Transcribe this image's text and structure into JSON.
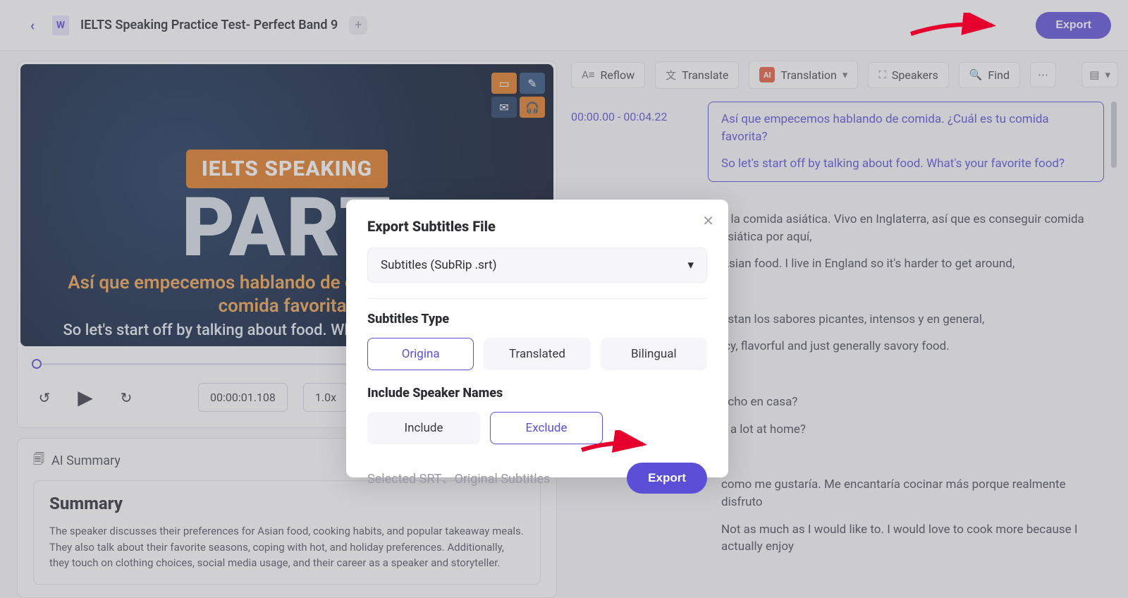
{
  "header": {
    "title": "IELTS Speaking Practice Test- Perfect Band 9",
    "export_label": "Export"
  },
  "video": {
    "tag": "IELTS SPEAKING",
    "big": "PART",
    "sub_es": "Así que empecemos hablando de comida. ¿Cuál es tu comida favorita?",
    "sub_en": "So let's start off by talking about food. What's your favorite food?"
  },
  "controls": {
    "timecode": "00:00:01.108",
    "speed": "1.0x"
  },
  "summary": {
    "section_title": "AI Summary",
    "heading": "Summary",
    "body": "The speaker discusses their preferences for Asian food, cooking habits, and popular takeaway meals. They also talk about their favorite seasons, coping with hot, and holiday preferences. Additionally, they touch on clothing choices, social media usage, and their career as a speaker and storyteller."
  },
  "toolbar": {
    "reflow": "Reflow",
    "translate": "Translate",
    "translation": "Translation",
    "speakers": "Speakers",
    "find": "Find"
  },
  "segments": [
    {
      "time": "00:00.00 - 00:04.22",
      "es": "Así que empecemos hablando de comida. ¿Cuál es tu comida favorita?",
      "en": "So let's start off by talking about food. What's your favorite food?",
      "active": true
    },
    {
      "time": "",
      "es": "a la comida asiática. Vivo en Inglaterra, así que es conseguir comida asiática por aquí,",
      "en": "Asian food. I live in England so it's harder to get around,"
    },
    {
      "time": "",
      "es": "ustan los sabores picantes, intensos y en general,",
      "en": "icy, flavorful and just generally savory food."
    },
    {
      "time": "",
      "es": "ucho en casa?",
      "en": "k a lot at home?"
    },
    {
      "time": "",
      "es": "como me gustaría. Me encantaría cocinar más porque realmente disfruto",
      "en": "Not as much as I would like to. I would love to cook more because I actually enjoy"
    }
  ],
  "modal": {
    "title": "Export Subtitles File",
    "format": "Subtitles (SubRip .srt)",
    "type_label": "Subtitles Type",
    "types": {
      "origina": "Origina",
      "translated": "Translated",
      "bilingual": "Bilingual"
    },
    "speaker_label": "Include Speaker Names",
    "speakers": {
      "include": "Include",
      "exclude": "Exclude"
    },
    "selected_text": "Selected SRT、Original Subtitles",
    "export": "Export"
  }
}
